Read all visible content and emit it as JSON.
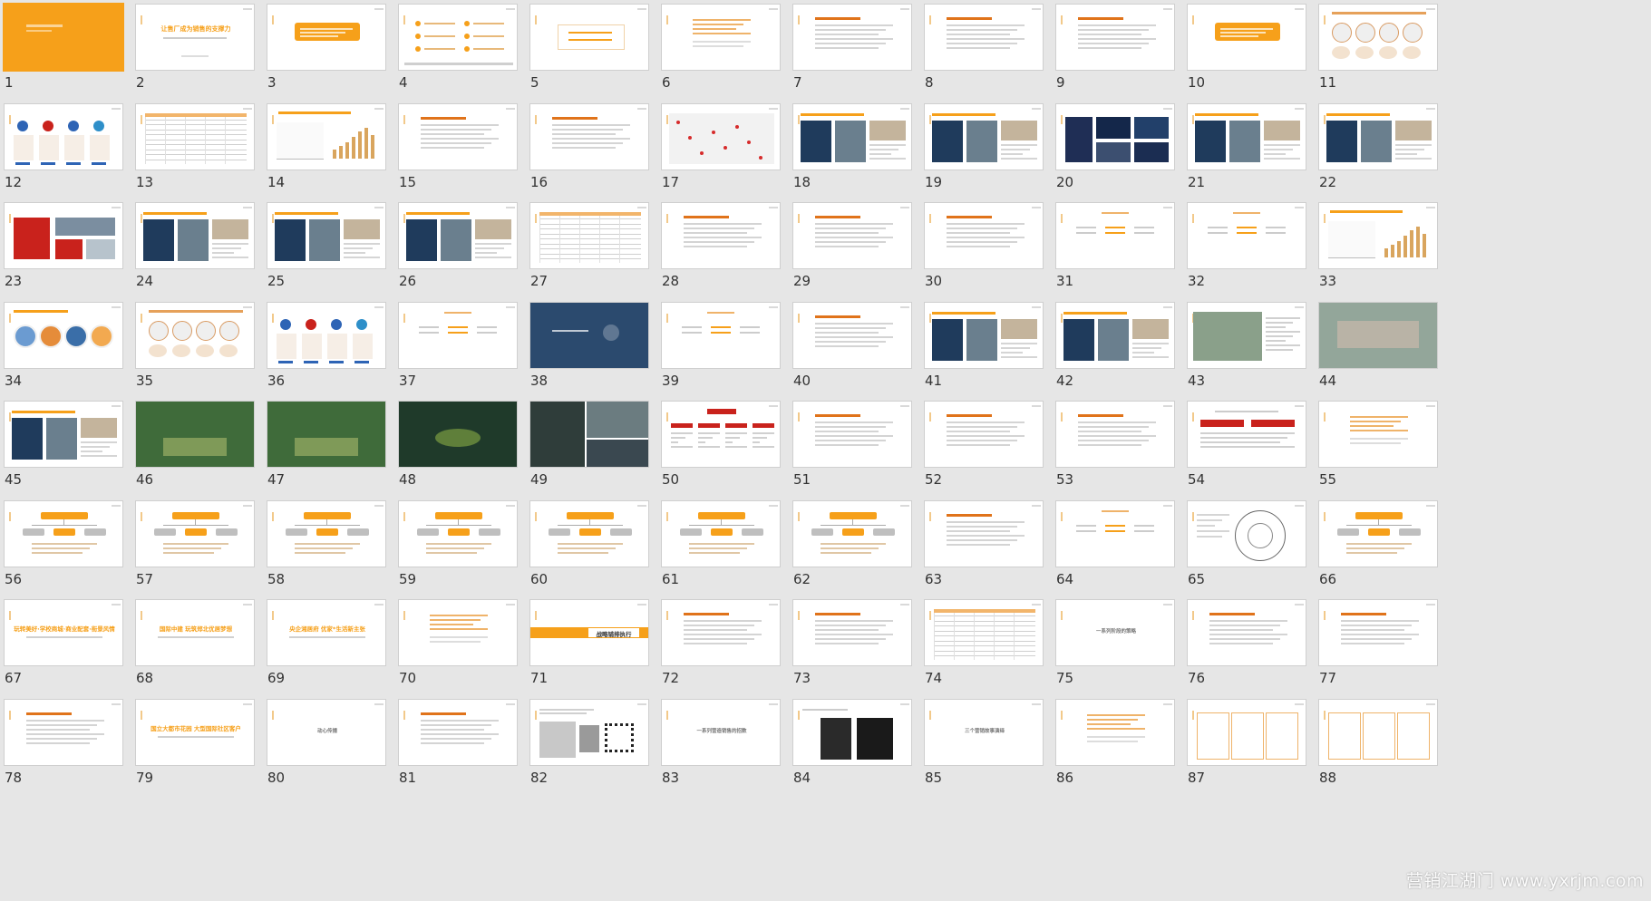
{
  "watermark": "营销江湖门 www.yxrjm.com",
  "colors": {
    "accent": "#f6a01a",
    "accent_dark": "#e0731a",
    "red": "#c9221c",
    "background": "#e6e6e6",
    "slide_bg": "#ffffff",
    "dark_blue": "#2b4a6e"
  },
  "slides": [
    {
      "n": "1",
      "t": "cover"
    },
    {
      "n": "2",
      "t": "title",
      "text": "让售厂成为销售的支撑力"
    },
    {
      "n": "3",
      "t": "orangebox"
    },
    {
      "n": "4",
      "t": "twocol"
    },
    {
      "n": "5",
      "t": "centertext"
    },
    {
      "n": "6",
      "t": "orangecenter"
    },
    {
      "n": "7",
      "t": "textpara"
    },
    {
      "n": "8",
      "t": "textpara"
    },
    {
      "n": "9",
      "t": "textpara"
    },
    {
      "n": "10",
      "t": "orangebox"
    },
    {
      "n": "11",
      "t": "diagram"
    },
    {
      "n": "12",
      "t": "icons"
    },
    {
      "n": "13",
      "t": "table"
    },
    {
      "n": "14",
      "t": "chart"
    },
    {
      "n": "15",
      "t": "textpara"
    },
    {
      "n": "16",
      "t": "textpara"
    },
    {
      "n": "17",
      "t": "map"
    },
    {
      "n": "18",
      "t": "photos"
    },
    {
      "n": "19",
      "t": "photos"
    },
    {
      "n": "20",
      "t": "dark"
    },
    {
      "n": "21",
      "t": "photos"
    },
    {
      "n": "22",
      "t": "photos"
    },
    {
      "n": "23",
      "t": "redphotos"
    },
    {
      "n": "24",
      "t": "photos"
    },
    {
      "n": "25",
      "t": "photos"
    },
    {
      "n": "26",
      "t": "photos"
    },
    {
      "n": "27",
      "t": "table"
    },
    {
      "n": "28",
      "t": "textpara"
    },
    {
      "n": "29",
      "t": "textpara"
    },
    {
      "n": "30",
      "t": "textpara"
    },
    {
      "n": "31",
      "t": "threecol"
    },
    {
      "n": "32",
      "t": "threecol"
    },
    {
      "n": "33",
      "t": "chart"
    },
    {
      "n": "34",
      "t": "pies"
    },
    {
      "n": "35",
      "t": "diagram"
    },
    {
      "n": "36",
      "t": "icons"
    },
    {
      "n": "37",
      "t": "threecol"
    },
    {
      "n": "38",
      "t": "bluebg"
    },
    {
      "n": "39",
      "t": "threecol"
    },
    {
      "n": "40",
      "t": "textpara"
    },
    {
      "n": "41",
      "t": "photos"
    },
    {
      "n": "42",
      "t": "photos"
    },
    {
      "n": "43",
      "t": "aerial"
    },
    {
      "n": "44",
      "t": "aerialfull"
    },
    {
      "n": "45",
      "t": "photos"
    },
    {
      "n": "46",
      "t": "greenfull"
    },
    {
      "n": "47",
      "t": "greenfull"
    },
    {
      "n": "48",
      "t": "darkgreen"
    },
    {
      "n": "49",
      "t": "darkphotos"
    },
    {
      "n": "50",
      "t": "redtree"
    },
    {
      "n": "51",
      "t": "textpara"
    },
    {
      "n": "52",
      "t": "textpara"
    },
    {
      "n": "53",
      "t": "textpara"
    },
    {
      "n": "54",
      "t": "redboxes"
    },
    {
      "n": "55",
      "t": "orangecenter"
    },
    {
      "n": "56",
      "t": "tree"
    },
    {
      "n": "57",
      "t": "tree"
    },
    {
      "n": "58",
      "t": "tree"
    },
    {
      "n": "59",
      "t": "tree"
    },
    {
      "n": "60",
      "t": "tree"
    },
    {
      "n": "61",
      "t": "tree"
    },
    {
      "n": "62",
      "t": "tree"
    },
    {
      "n": "63",
      "t": "textpara"
    },
    {
      "n": "64",
      "t": "threecol"
    },
    {
      "n": "65",
      "t": "circles"
    },
    {
      "n": "66",
      "t": "tree"
    },
    {
      "n": "67",
      "t": "headline",
      "text": "玩转美好·学校商城·商业配套·街景风情"
    },
    {
      "n": "68",
      "t": "headline",
      "text": "国际中建 玩筑郑北优居梦想"
    },
    {
      "n": "69",
      "t": "headline",
      "text": "央企湘居府 优家*生活新主张"
    },
    {
      "n": "70",
      "t": "orangecenter"
    },
    {
      "n": "71",
      "t": "banner",
      "text": "战略铺排执行"
    },
    {
      "n": "72",
      "t": "textpara"
    },
    {
      "n": "73",
      "t": "textpara"
    },
    {
      "n": "74",
      "t": "table"
    },
    {
      "n": "75",
      "t": "centersmall",
      "text": "一系列阶段的策略"
    },
    {
      "n": "76",
      "t": "textpara"
    },
    {
      "n": "77",
      "t": "textpara"
    },
    {
      "n": "78",
      "t": "textpara"
    },
    {
      "n": "79",
      "t": "headline",
      "text": "国立大都市花园 大型国际社区客户"
    },
    {
      "n": "80",
      "t": "centersmall",
      "text": "动心传播"
    },
    {
      "n": "81",
      "t": "textpara"
    },
    {
      "n": "82",
      "t": "qrphotos"
    },
    {
      "n": "83",
      "t": "centersmall",
      "text": "一系列营造销售的招数"
    },
    {
      "n": "84",
      "t": "darkphotos2"
    },
    {
      "n": "85",
      "t": "centersmall",
      "text": "三个营销故事演绎"
    },
    {
      "n": "86",
      "t": "orangecenter"
    },
    {
      "n": "87",
      "t": "boxes"
    },
    {
      "n": "88",
      "t": "boxes"
    }
  ]
}
